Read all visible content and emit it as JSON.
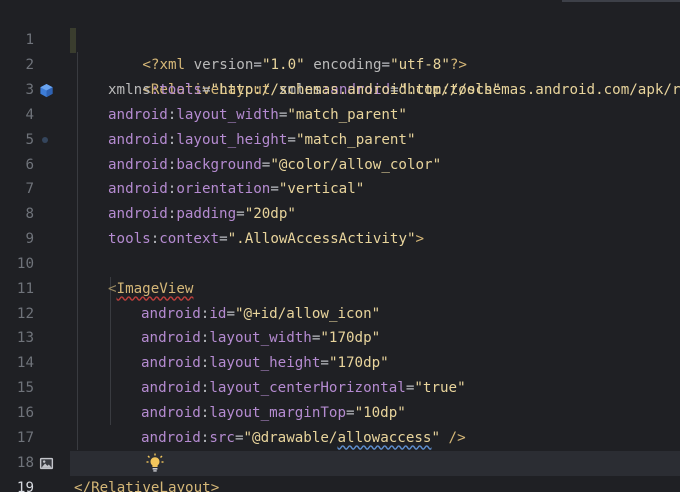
{
  "editor": {
    "current_line": 19,
    "colors": {
      "background": "#1f2024",
      "current_line": "#2b2d33",
      "tag": "#d5b778",
      "namespace": "#b58bd1",
      "string": "#e8d49c",
      "line_number": "#6f737a"
    },
    "gutter": {
      "line_numbers": [
        "1",
        "2",
        "3",
        "4",
        "5",
        "6",
        "7",
        "8",
        "9",
        "10",
        "11",
        "12",
        "13",
        "14",
        "15",
        "16",
        "17",
        "18",
        "19"
      ],
      "icons": {
        "line_2": "component-cube-icon",
        "line_6": "color-swatch-icon",
        "line_17": "image-preview-icon"
      }
    },
    "lines": {
      "l1": {
        "open": "<?",
        "name": "xml",
        "attr1": " version",
        "eq1": "=",
        "val1": "\"1.0\"",
        "attr2": " encoding",
        "eq2": "=",
        "val2": "\"utf-8\"",
        "close": "?>"
      },
      "l2": {
        "open": "<",
        "tag": "RelativeLayout",
        "sp": " ",
        "ns": "xmlns",
        "colon": ":",
        "attr": "android",
        "eq": "=",
        "val": "\"http://schemas.android.com/apk/res/android\""
      },
      "l3": {
        "ns": "xmlns",
        "colon": ":",
        "attr": "tools",
        "eq": "=",
        "val": "\"http://schemas.android.com/tools\""
      },
      "l4": {
        "ns": "android",
        "colon": ":",
        "attr": "layout_width",
        "eq": "=",
        "val": "\"match_parent\""
      },
      "l5": {
        "ns": "android",
        "colon": ":",
        "attr": "layout_height",
        "eq": "=",
        "val": "\"match_parent\""
      },
      "l6": {
        "ns": "android",
        "colon": ":",
        "attr": "background",
        "eq": "=",
        "val": "\"@color/allow_color\""
      },
      "l7": {
        "ns": "android",
        "colon": ":",
        "attr": "orientation",
        "eq": "=",
        "val": "\"vertical\""
      },
      "l8": {
        "ns": "android",
        "colon": ":",
        "attr": "padding",
        "eq": "=",
        "val": "\"20dp\""
      },
      "l9": {
        "ns": "tools",
        "colon": ":",
        "attr": "context",
        "eq": "=",
        "val": "\".AllowAccessActivity\"",
        "close": ">"
      },
      "l11": {
        "open": "<",
        "tag": "ImageView"
      },
      "l12": {
        "ns": "android",
        "colon": ":",
        "attr": "id",
        "eq": "=",
        "val": "\"@+id/allow_icon\""
      },
      "l13": {
        "ns": "android",
        "colon": ":",
        "attr": "layout_width",
        "eq": "=",
        "val": "\"170dp\""
      },
      "l14": {
        "ns": "android",
        "colon": ":",
        "attr": "layout_height",
        "eq": "=",
        "val": "\"170dp\""
      },
      "l15": {
        "ns": "android",
        "colon": ":",
        "attr": "layout_centerHorizontal",
        "eq": "=",
        "val": "\"true\""
      },
      "l16": {
        "ns": "android",
        "colon": ":",
        "attr": "layout_marginTop",
        "eq": "=",
        "val": "\"10dp\""
      },
      "l17": {
        "ns": "android",
        "colon": ":",
        "attr": "src",
        "eq": "=",
        "val_open": "\"@drawable/",
        "val_ul": "allowaccess",
        "val_close": "\"",
        "close": " />"
      },
      "l18": {
        "icon": "lightbulb-intention-icon"
      },
      "l19": {
        "open": "</",
        "tag": "RelativeLayout",
        "close": ">"
      }
    }
  }
}
